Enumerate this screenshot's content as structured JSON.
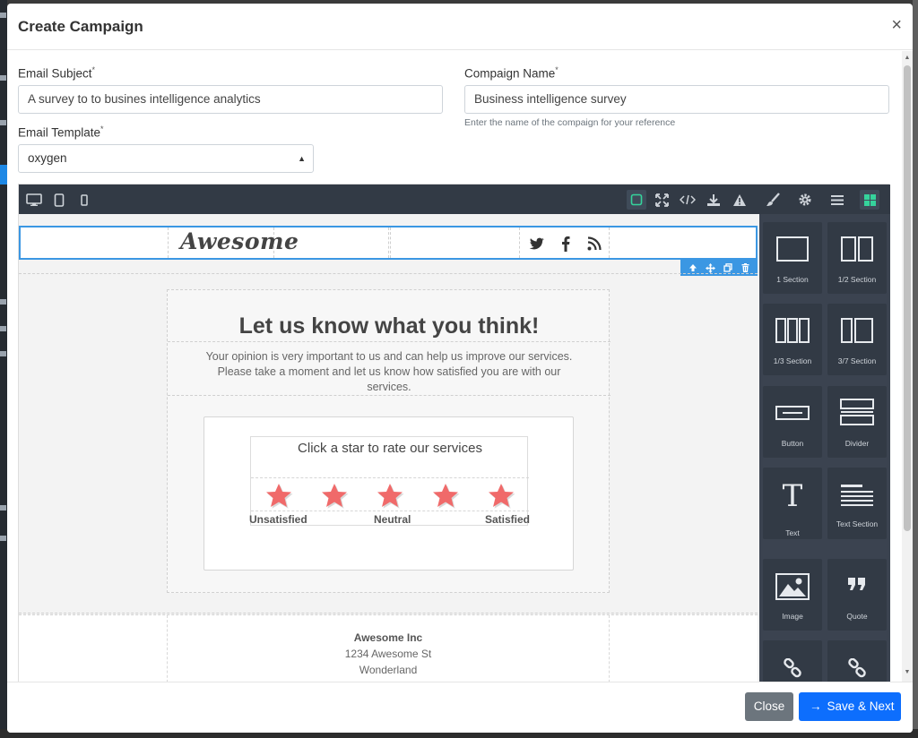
{
  "modal": {
    "title": "Create Campaign",
    "close_glyph": "×"
  },
  "form": {
    "email_subject": {
      "label": "Email Subject",
      "required_mark": "*",
      "value": "A survey to to busines intelligence analytics"
    },
    "campaign_name": {
      "label": "Compaign Name",
      "required_mark": "*",
      "value": "Business intelligence survey",
      "help": "Enter the name of the compaign for your reference"
    },
    "email_template": {
      "label": "Email Template",
      "required_mark": "*",
      "selected": "oxygen"
    }
  },
  "builder": {
    "toolbar_left": [
      "desktop-icon",
      "tablet-icon",
      "mobile-icon"
    ],
    "toolbar_right": [
      "border-toggle-icon",
      "fullscreen-icon",
      "code-icon",
      "download-icon",
      "warning-icon",
      "paint-brush-icon",
      "gear-icon",
      "layers-icon",
      "blocks-icon"
    ],
    "blocks": [
      {
        "label": "1 Section",
        "icon": "one-section-icon"
      },
      {
        "label": "1/2 Section",
        "icon": "half-section-icon"
      },
      {
        "label": "1/3 Section",
        "icon": "third-section-icon"
      },
      {
        "label": "3/7 Section",
        "icon": "three-seven-section-icon"
      },
      {
        "label": "Button",
        "icon": "button-block-icon"
      },
      {
        "label": "Divider",
        "icon": "divider-block-icon"
      },
      {
        "label": "Text",
        "icon": "text-block-icon"
      },
      {
        "label": "Text Section",
        "icon": "text-section-icon"
      },
      {
        "label": "Image",
        "icon": "image-block-icon"
      },
      {
        "label": "Quote",
        "icon": "quote-block-icon"
      },
      {
        "label": "",
        "icon": "link-block-icon"
      },
      {
        "label": "",
        "icon": "link-block-icon"
      }
    ]
  },
  "email": {
    "logo_text": "Awesome",
    "social": [
      "twitter-icon",
      "facebook-icon",
      "rss-icon"
    ],
    "row_tools": [
      "move-up-icon",
      "drag-icon",
      "clone-icon",
      "delete-icon"
    ],
    "headline": "Let us know what you think!",
    "intro": "Your opinion is very important to us and can help us improve our services. Please take a moment and let us know how satisfied you are with our services.",
    "rating_title": "Click a star to rate our services",
    "star_count": 5,
    "star_color": "#f06a6a",
    "rating_labels": {
      "low": "Unsatisfied",
      "mid": "Neutral",
      "high": "Satisfied"
    },
    "footer": {
      "company": "Awesome Inc",
      "street": "1234 Awesome St",
      "city": "Wonderland"
    }
  },
  "footer_buttons": {
    "close_label": "Close",
    "save_label": "Save & Next",
    "save_arrow": "→"
  },
  "colors": {
    "primary": "#0d6efd",
    "secondary": "#6c757d",
    "selection": "#3b97e3",
    "toolbar": "#323a45"
  }
}
